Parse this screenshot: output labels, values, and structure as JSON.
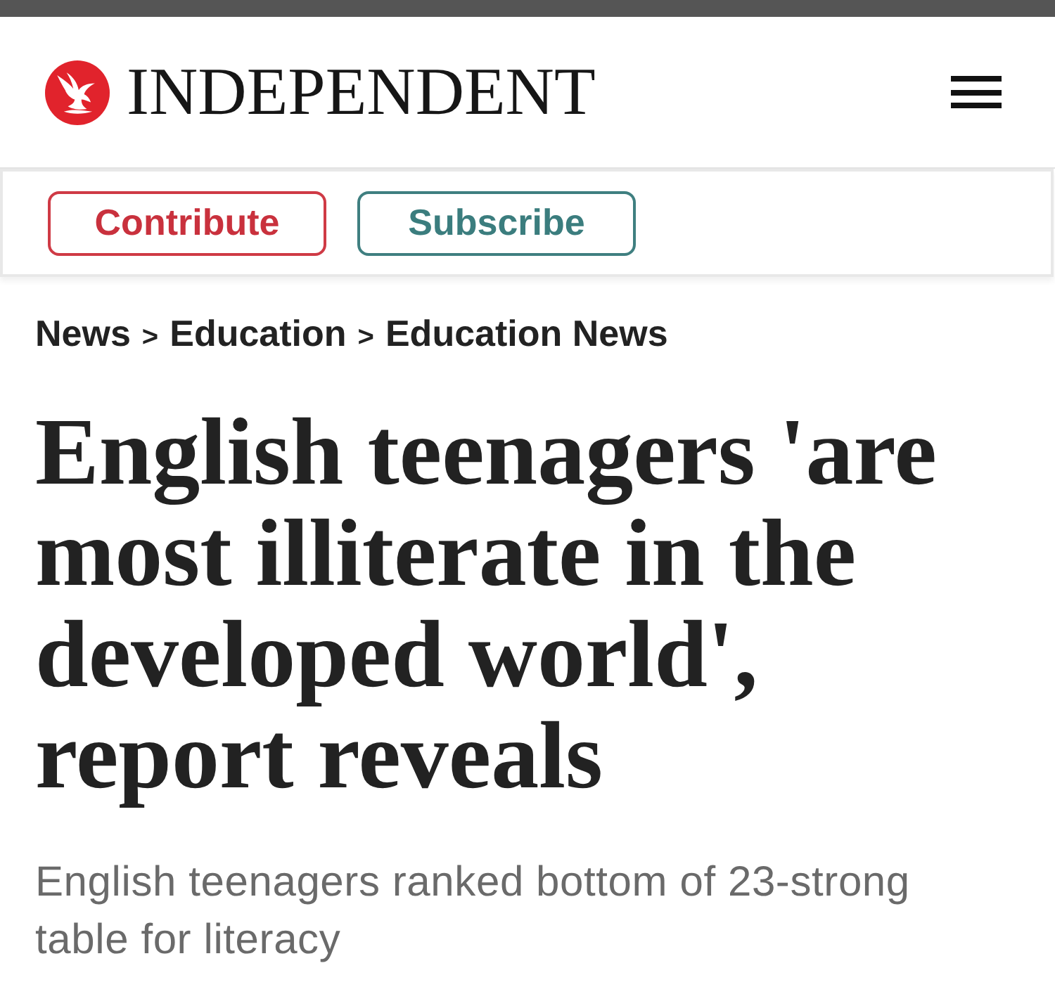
{
  "masthead": {
    "wordmark": "INDEPENDENT"
  },
  "actions": [
    {
      "label": "Contribute",
      "kind": "contribute"
    },
    {
      "label": "Subscribe",
      "kind": "subscribe"
    }
  ],
  "breadcrumb": [
    {
      "label": "News",
      "separator": ">"
    },
    {
      "label": "Education",
      "separator": ">"
    },
    {
      "label": "Education News"
    }
  ],
  "headline": "English teenagers 'are most illiterate in the developed world', report reveals",
  "standfirst": "English teenagers ranked bottom of 23-strong table for literacy"
}
